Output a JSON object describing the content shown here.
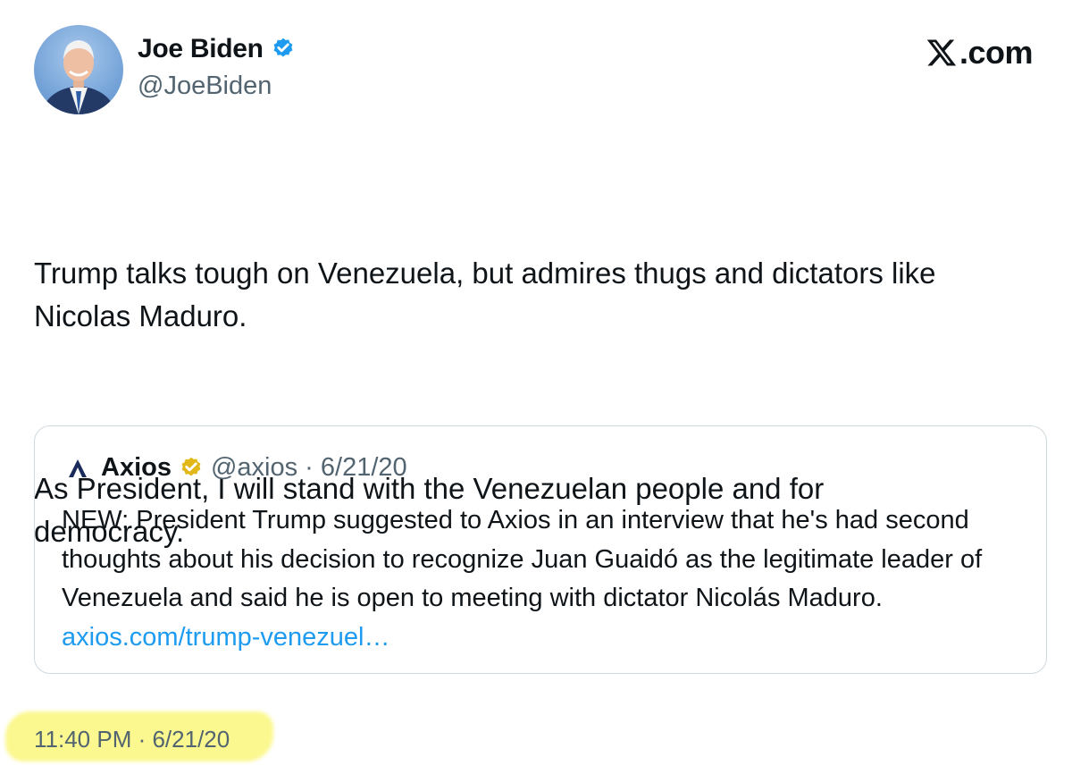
{
  "author": {
    "name": "Joe Biden",
    "handle": "@JoeBiden",
    "avatar_icon": "person-portrait"
  },
  "brand": {
    "text": ".com",
    "icon": "x-logo-icon"
  },
  "tweet": {
    "paragraphs": [
      "Trump talks tough on Venezuela, but admires thugs and dictators like\nNicolas Maduro.",
      "As President, I will stand with the Venezuelan people and for\ndemocracy."
    ],
    "timestamp": "11:40 PM · 6/21/20"
  },
  "quote": {
    "name": "Axios",
    "handle_and_date": "@axios · 6/21/20",
    "text": "NEW: President Trump suggested to Axios in an interview that he's had second thoughts about his decision to recognize Juan Guaidó as the legitimate leader of Venezuela and said he is open to meeting with dictator Nicolás Maduro. ",
    "link": "axios.com/trump-venezuel…"
  },
  "colors": {
    "verified_blue": "#1d9bf0",
    "verified_gold": "#e2b719",
    "link": "#1d9bf0",
    "highlight": "#faf669"
  }
}
